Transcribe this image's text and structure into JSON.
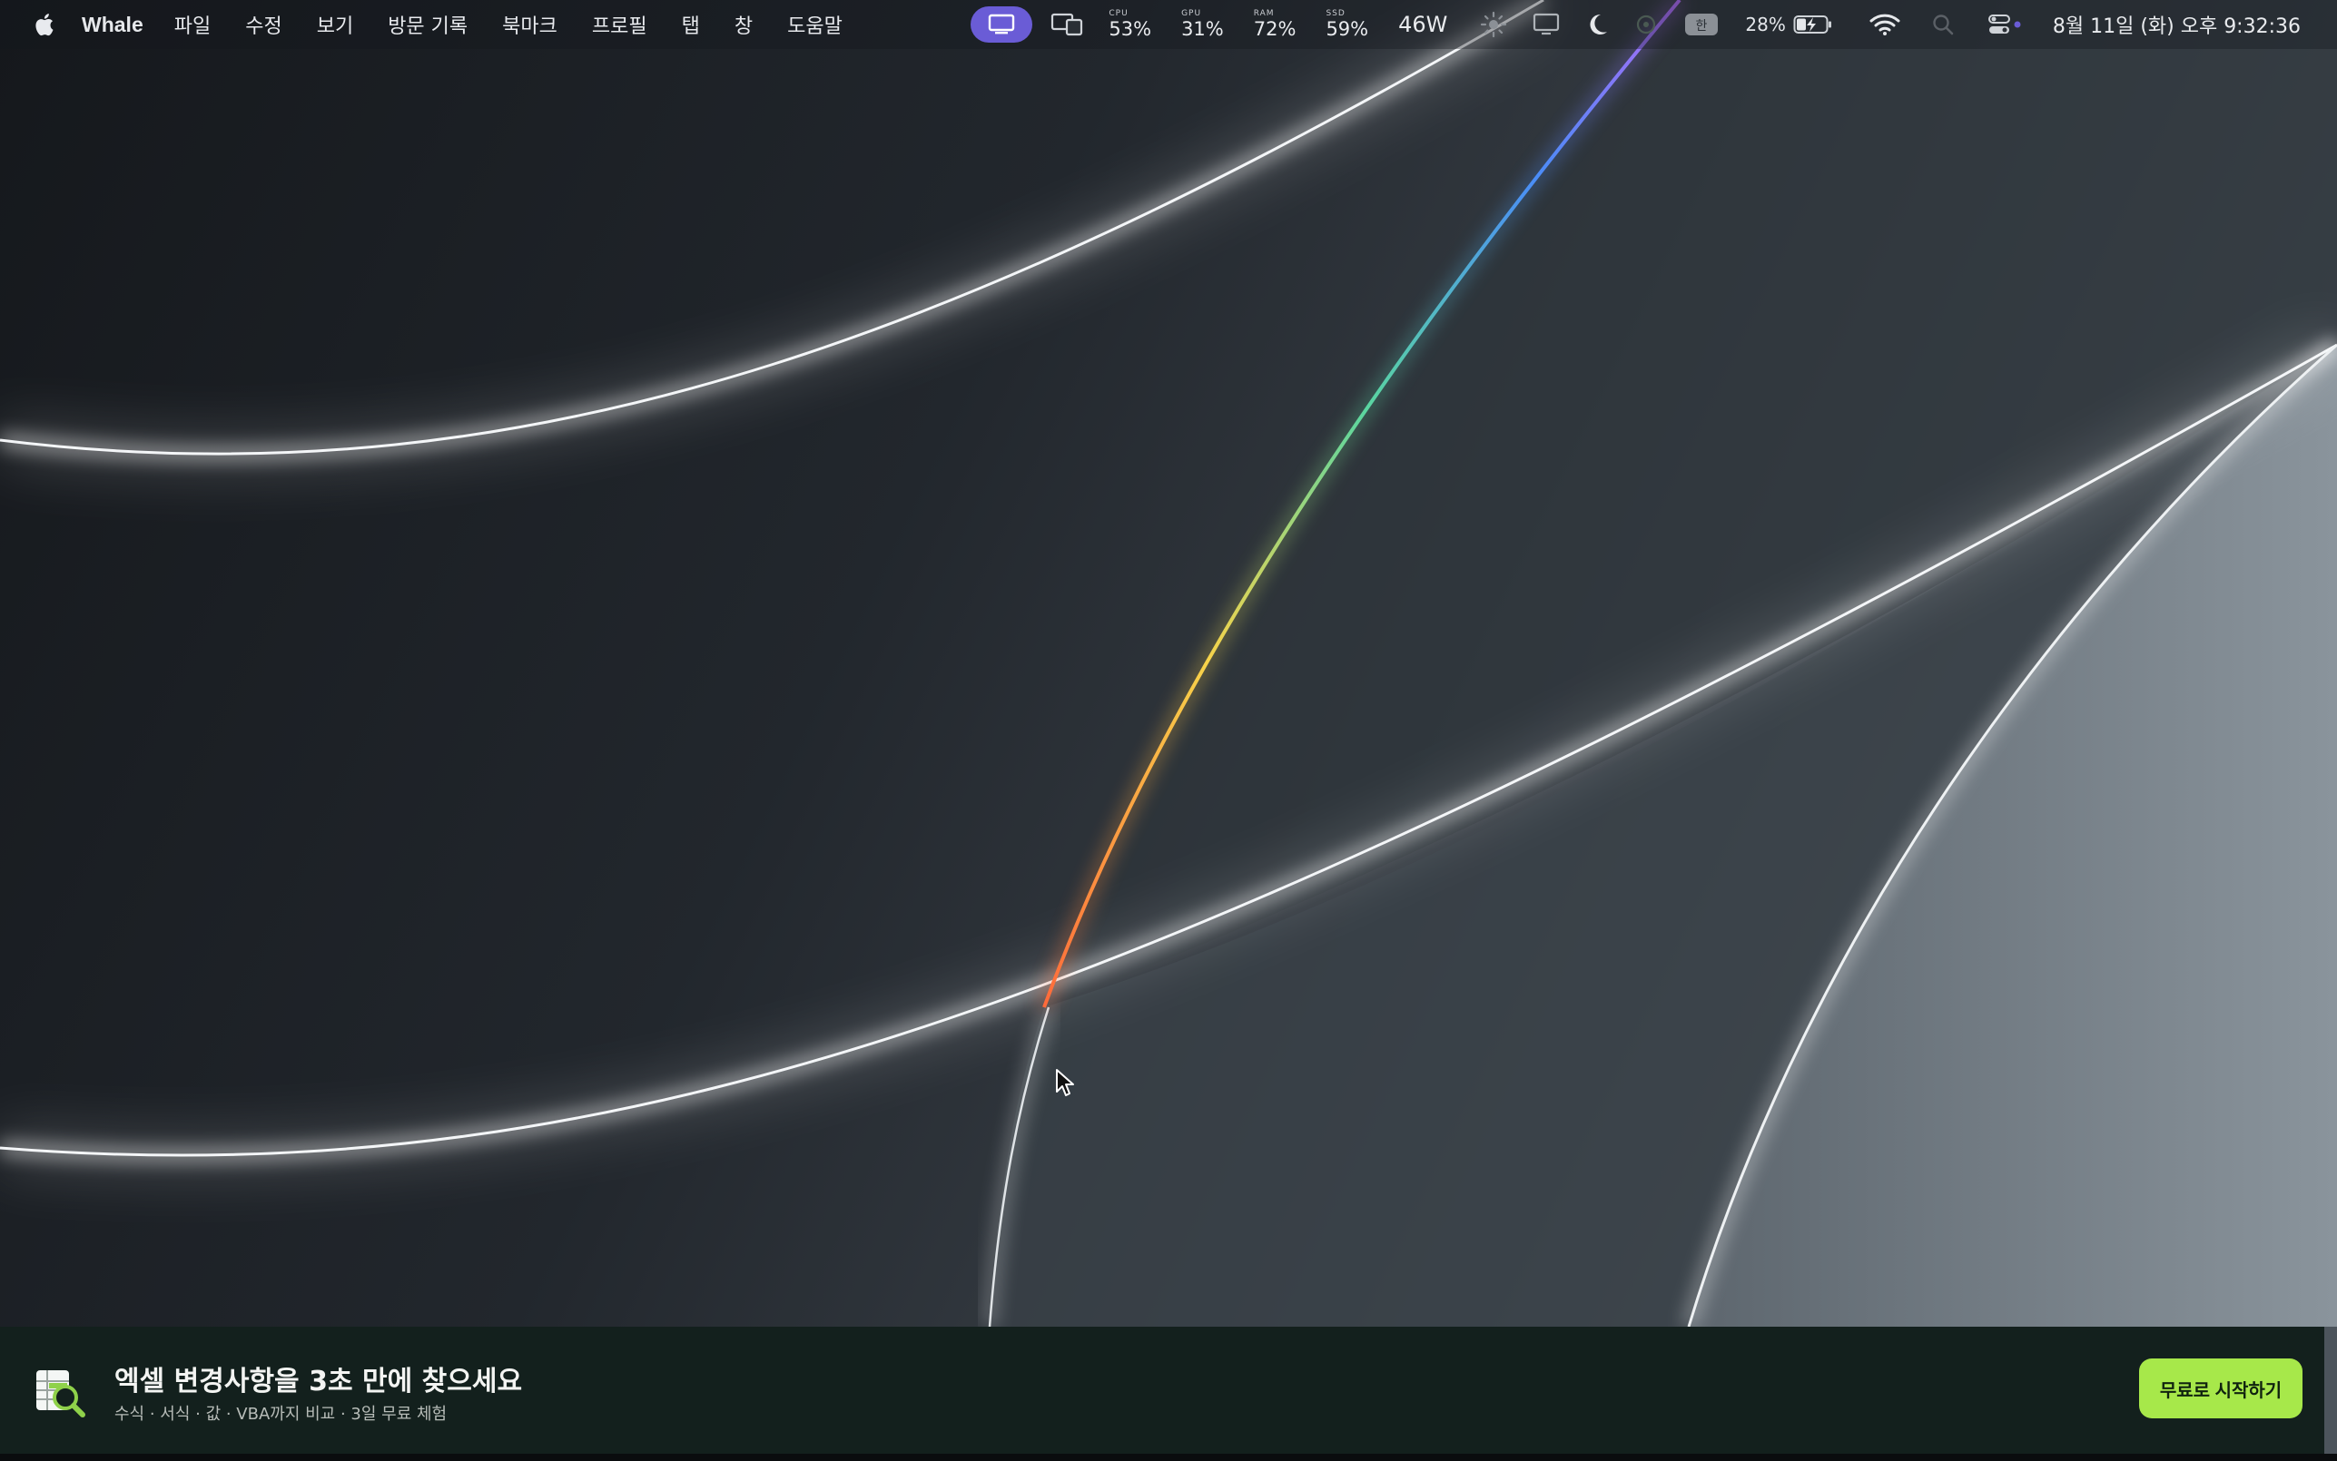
{
  "menubar": {
    "apple_icon": "apple-logo-icon",
    "app_name": "Whale",
    "menus": [
      "파일",
      "수정",
      "보기",
      "방문 기록",
      "북마크",
      "프로필",
      "탭",
      "창",
      "도움말"
    ],
    "stats": [
      {
        "label": "CPU",
        "value": "53%"
      },
      {
        "label": "GPU",
        "value": "31%"
      },
      {
        "label": "RAM",
        "value": "72%"
      },
      {
        "label": "SSD",
        "value": "59%"
      }
    ],
    "power": "46W",
    "battery_percent": "28%",
    "clock": "8월 11일 (화) 오후 9:32:36",
    "accent_color": "#6a5cd6"
  },
  "ad": {
    "title": "엑셀 변경사항을 3초 만에 찾으세요",
    "subtitle": "수식 · 서식 · 값 · VBA까지 비교 · 3일 무료 체험",
    "cta_label": "무료로 시작하기",
    "cta_color": "#a7e84a"
  }
}
